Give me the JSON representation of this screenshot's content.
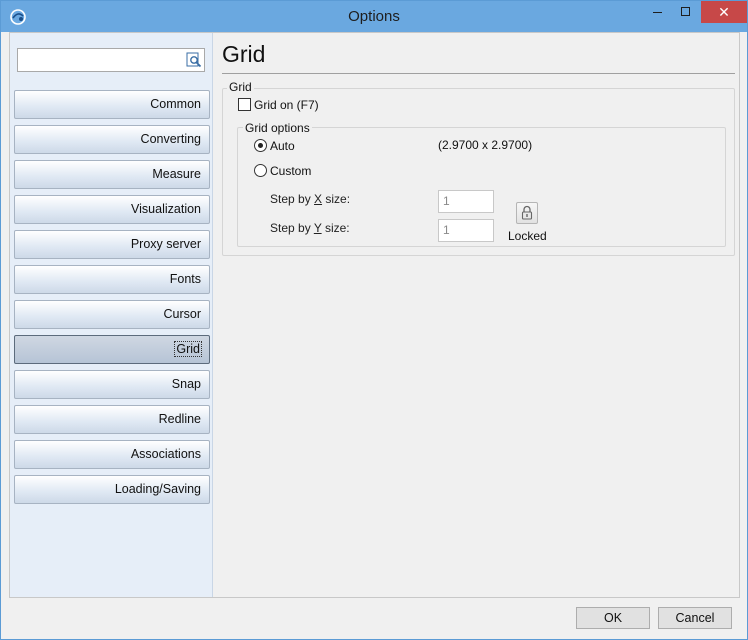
{
  "window": {
    "title": "Options"
  },
  "sidebar": {
    "search": {
      "value": "",
      "placeholder": ""
    },
    "items": [
      {
        "label": "Common"
      },
      {
        "label": "Converting"
      },
      {
        "label": "Measure"
      },
      {
        "label": "Visualization"
      },
      {
        "label": "Proxy server"
      },
      {
        "label": "Fonts"
      },
      {
        "label": "Cursor"
      },
      {
        "label": "Grid",
        "active": true
      },
      {
        "label": "Snap"
      },
      {
        "label": "Redline"
      },
      {
        "label": "Associations"
      },
      {
        "label": "Loading/Saving"
      }
    ]
  },
  "main": {
    "page_title": "Grid",
    "grid_group": {
      "legend": "Grid",
      "grid_on": {
        "label": "Grid on (F7)",
        "checked": false
      }
    },
    "options_group": {
      "legend": "Grid options",
      "auto": {
        "label": "Auto",
        "selected": true,
        "value": "(2.9700 x 2.9700)"
      },
      "custom": {
        "label": "Custom",
        "selected": false
      },
      "step_x": {
        "prefix": "Step by ",
        "key": "X",
        "suffix": " size:",
        "value": "1"
      },
      "step_y": {
        "prefix": "Step by ",
        "key": "Y",
        "suffix": " size:",
        "value": "1"
      },
      "lock_label": "Locked"
    }
  },
  "footer": {
    "ok_label": "OK",
    "cancel_label": "Cancel"
  },
  "colors": {
    "titlebar": "#6aa8e0",
    "close_button": "#c74848",
    "sidebar_bg": "#e6eef8"
  }
}
